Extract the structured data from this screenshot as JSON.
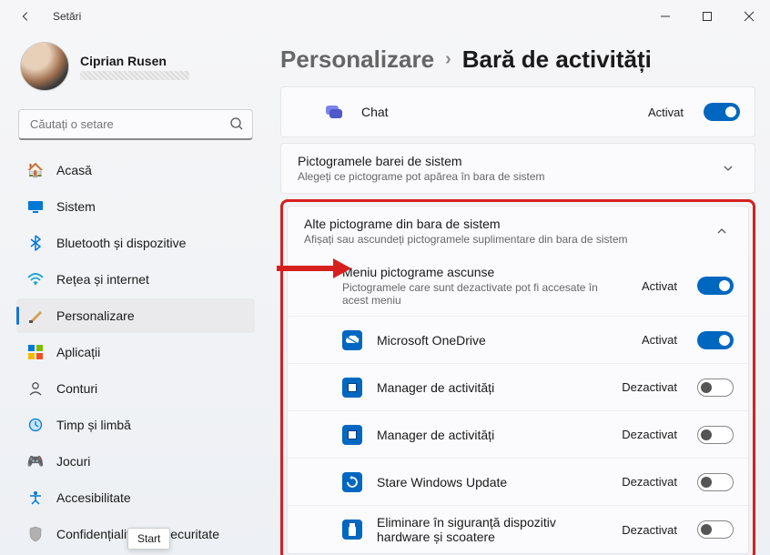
{
  "window": {
    "title": "Setări"
  },
  "user": {
    "name": "Ciprian Rusen"
  },
  "search": {
    "placeholder": "Căutați o setare"
  },
  "nav": {
    "items": [
      {
        "label": "Acasă"
      },
      {
        "label": "Sistem"
      },
      {
        "label": "Bluetooth și dispozitive"
      },
      {
        "label": "Rețea și internet"
      },
      {
        "label": "Personalizare"
      },
      {
        "label": "Aplicații"
      },
      {
        "label": "Conturi"
      },
      {
        "label": "Timp și limbă"
      },
      {
        "label": "Jocuri"
      },
      {
        "label": "Accesibilitate"
      },
      {
        "label": "Confidențialitate și securitate"
      }
    ]
  },
  "breadcrumb": {
    "parent": "Personalizare",
    "current": "Bară de activități"
  },
  "chat_row": {
    "title": "Chat",
    "status": "Activat"
  },
  "systray_card": {
    "title": "Pictogramele barei de sistem",
    "sub": "Alegeți ce pictograme pot apărea în bara de sistem"
  },
  "other_card": {
    "title": "Alte pictograme din bara de sistem",
    "sub": "Afișați sau ascundeți pictogramele suplimentare din bara de sistem",
    "hidden_menu": {
      "title": "Meniu pictograme ascunse",
      "sub": "Pictogramele care sunt dezactivate pot fi accesate în acest meniu",
      "status": "Activat"
    },
    "apps": [
      {
        "title": "Microsoft OneDrive",
        "status": "Activat",
        "on": true,
        "icon": "cloud"
      },
      {
        "title": "Manager de activități",
        "status": "Dezactivat",
        "on": false,
        "icon": "square"
      },
      {
        "title": "Manager de activități",
        "status": "Dezactivat",
        "on": false,
        "icon": "square"
      },
      {
        "title": "Stare Windows Update",
        "status": "Dezactivat",
        "on": false,
        "icon": "update"
      },
      {
        "title": "Eliminare în siguranță dispozitiv hardware și scoatere",
        "status": "Dezactivat",
        "on": false,
        "icon": "usb"
      }
    ]
  },
  "tooltip": "Start"
}
